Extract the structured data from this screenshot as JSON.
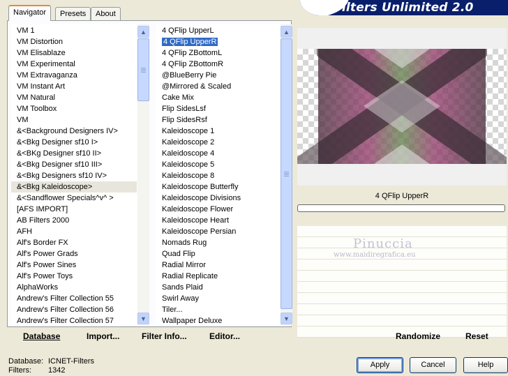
{
  "header": {
    "title": "Filters Unlimited 2.0"
  },
  "tabs": [
    {
      "label": "Navigator",
      "active": true
    },
    {
      "label": "Presets",
      "active": false
    },
    {
      "label": "About",
      "active": false
    }
  ],
  "categories": {
    "items": [
      "VM 1",
      "VM Distortion",
      "VM Elisablaze",
      "VM Experimental",
      "VM Extravaganza",
      "VM Instant Art",
      "VM Natural",
      "VM Toolbox",
      "VM",
      "&<Background Designers IV>",
      "&<Bkg Designer sf10 I>",
      "&<BKg Designer sf10 II>",
      "&<Bkg Designer sf10 III>",
      "&<Bkg Designers sf10 IV>",
      "&<Bkg Kaleidoscope>",
      "&<Sandflower Specials^v^ >",
      "[AFS IMPORT]",
      "AB Filters 2000",
      "AFH",
      "Alf's Border FX",
      "Alf's Power Grads",
      "Alf's Power Sines",
      "Alf's Power Toys",
      "AlphaWorks",
      "Andrew's Filter Collection 55",
      "Andrew's Filter Collection 56",
      "Andrew's Filter Collection 57"
    ],
    "selected_index": 14
  },
  "filters": {
    "items": [
      "4 QFlip UpperL",
      "4 QFlip UpperR",
      "4 QFlip ZBottomL",
      "4 QFlip ZBottomR",
      "@BlueBerry Pie",
      "@Mirrored & Scaled",
      "Cake Mix",
      "Flip SidesLsf",
      "Flip SidesRsf",
      "Kaleidoscope 1",
      "Kaleidoscope 2",
      "Kaleidoscope 4",
      "Kaleidoscope 5",
      "Kaleidoscope 8",
      "Kaleidoscope Butterfly",
      "Kaleidoscope Divisions",
      "Kaleidoscope Flower",
      "Kaleidoscope Heart",
      "Kaleidoscope Persian",
      "Nomads Rug",
      "Quad Flip",
      "Radial Mirror",
      "Radial Replicate",
      "Sands Plaid",
      "Swirl Away",
      "Tiler...",
      "Wallpaper Deluxe"
    ],
    "selected_index": 1
  },
  "toolbar": {
    "database": "Database",
    "import": "Import...",
    "filter_info": "Filter Info...",
    "editor": "Editor..."
  },
  "preview": {
    "filter_name": "4 QFlip UpperR",
    "progress": 0,
    "watermark_name": "Pinuccia",
    "watermark_url": "www.maidiregrafica.eu"
  },
  "actions": {
    "randomize": "Randomize",
    "reset": "Reset"
  },
  "status": {
    "database_label": "Database:",
    "database_value": "ICNET-Filters",
    "filters_label": "Filters:",
    "filters_value": "1342"
  },
  "buttons": {
    "apply": "Apply",
    "cancel": "Cancel",
    "help": "Help"
  },
  "colors": {
    "title_bar": "#0a1f6b",
    "selection": "#316ac5",
    "preview_magenta": "#9b4a76",
    "preview_green": "#6f8a5b",
    "preview_dark": "#3e2f38"
  }
}
